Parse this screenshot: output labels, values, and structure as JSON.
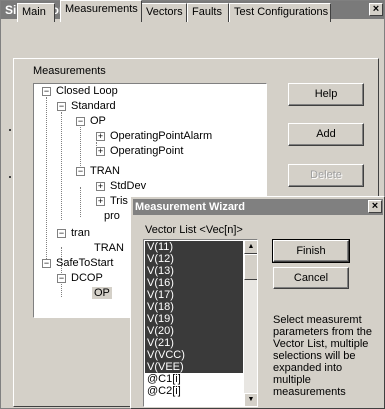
{
  "window": {
    "title": "Simulation Control",
    "close_glyph": "×"
  },
  "tabs": [
    {
      "label": "Main"
    },
    {
      "label": "Measurements"
    },
    {
      "label": "Vectors"
    },
    {
      "label": "Faults"
    },
    {
      "label": "Test Configurations"
    }
  ],
  "measurements": {
    "group_label": "Measurements",
    "tree": [
      {
        "label": "Closed Loop"
      },
      {
        "label": "Standard"
      },
      {
        "label": "OP"
      },
      {
        "label": "OperatingPointAlarm"
      },
      {
        "label": "OperatingPoint"
      },
      {
        "label": "TRAN"
      },
      {
        "label": "StdDev"
      },
      {
        "label": "Tris"
      },
      {
        "label": "pro"
      },
      {
        "label": "tran"
      },
      {
        "label": "TRAN"
      },
      {
        "label": "SafeToStart"
      },
      {
        "label": "DCOP"
      },
      {
        "label": "OP"
      }
    ],
    "buttons": {
      "help": "Help",
      "add": "Add",
      "delete": "Delete"
    }
  },
  "wizard": {
    "title": "Measurement Wizard",
    "close_glyph": "×",
    "list_label": "Vector List  <Vec[n]>",
    "items": [
      {
        "label": "V(11)",
        "selected": true
      },
      {
        "label": "V(12)",
        "selected": true
      },
      {
        "label": "V(13)",
        "selected": true
      },
      {
        "label": "V(16)",
        "selected": true
      },
      {
        "label": "V(17)",
        "selected": true
      },
      {
        "label": "V(18)",
        "selected": true
      },
      {
        "label": "V(19)",
        "selected": true
      },
      {
        "label": "V(20)",
        "selected": true
      },
      {
        "label": "V(21)",
        "selected": true
      },
      {
        "label": "V(VCC)",
        "selected": true
      },
      {
        "label": "V(VEE)",
        "selected": true
      },
      {
        "label": "@C1[i]",
        "selected": false
      },
      {
        "label": "@C2[i]",
        "selected": false
      }
    ],
    "finish_label": "Finish",
    "cancel_label": "Cancel",
    "help_text": "Select measuremt parameters from the Vector List, multiple selections will be expanded into multiple measurements"
  }
}
